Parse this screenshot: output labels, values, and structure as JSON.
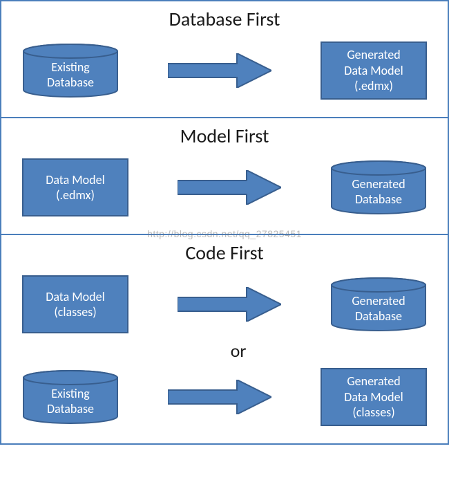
{
  "panels": {
    "dbFirst": {
      "title": "Database First",
      "left": "Existing\nDatabase",
      "right": "Generated\nData Model\n(.edmx)"
    },
    "modelFirst": {
      "title": "Model First",
      "left": "Data Model\n(.edmx)",
      "right": "Generated\nDatabase"
    },
    "codeFirst": {
      "title": "Code First",
      "row1": {
        "left": "Data Model\n(classes)",
        "right": "Generated\nDatabase"
      },
      "or": "or",
      "row2": {
        "left": "Existing\nDatabase",
        "right": "Generated\nData Model\n(classes)"
      }
    }
  },
  "watermark": "http://blog.csdn.net/qq_27825451",
  "colors": {
    "fill": "#4f81bd",
    "stroke": "#385e8e"
  }
}
